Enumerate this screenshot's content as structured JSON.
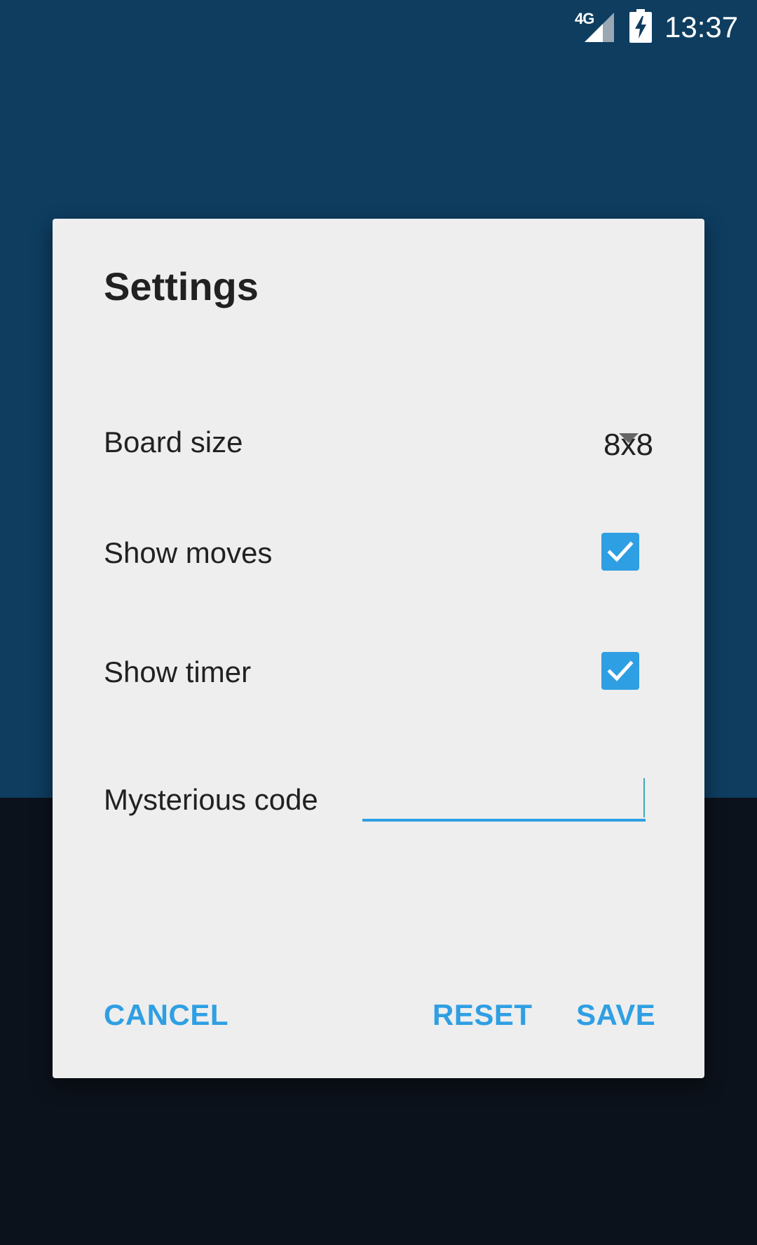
{
  "status_bar": {
    "network": "4G",
    "time": "13:37",
    "icons": [
      "signal-icon",
      "battery-charging-icon"
    ]
  },
  "dialog": {
    "title": "Settings",
    "board_size": {
      "label": "Board size",
      "value": "8x8"
    },
    "show_moves": {
      "label": "Show moves",
      "checked": true
    },
    "show_timer": {
      "label": "Show timer",
      "checked": true
    },
    "mysterious_code": {
      "label": "Mysterious code",
      "value": ""
    },
    "buttons": {
      "cancel": "CANCEL",
      "reset": "RESET",
      "save": "SAVE"
    }
  },
  "colors": {
    "background_top": "#0e3d60",
    "background_bottom": "#0c121b",
    "dialog_bg": "#eeeeee",
    "accent": "#2f9fe3",
    "text": "#212121"
  }
}
